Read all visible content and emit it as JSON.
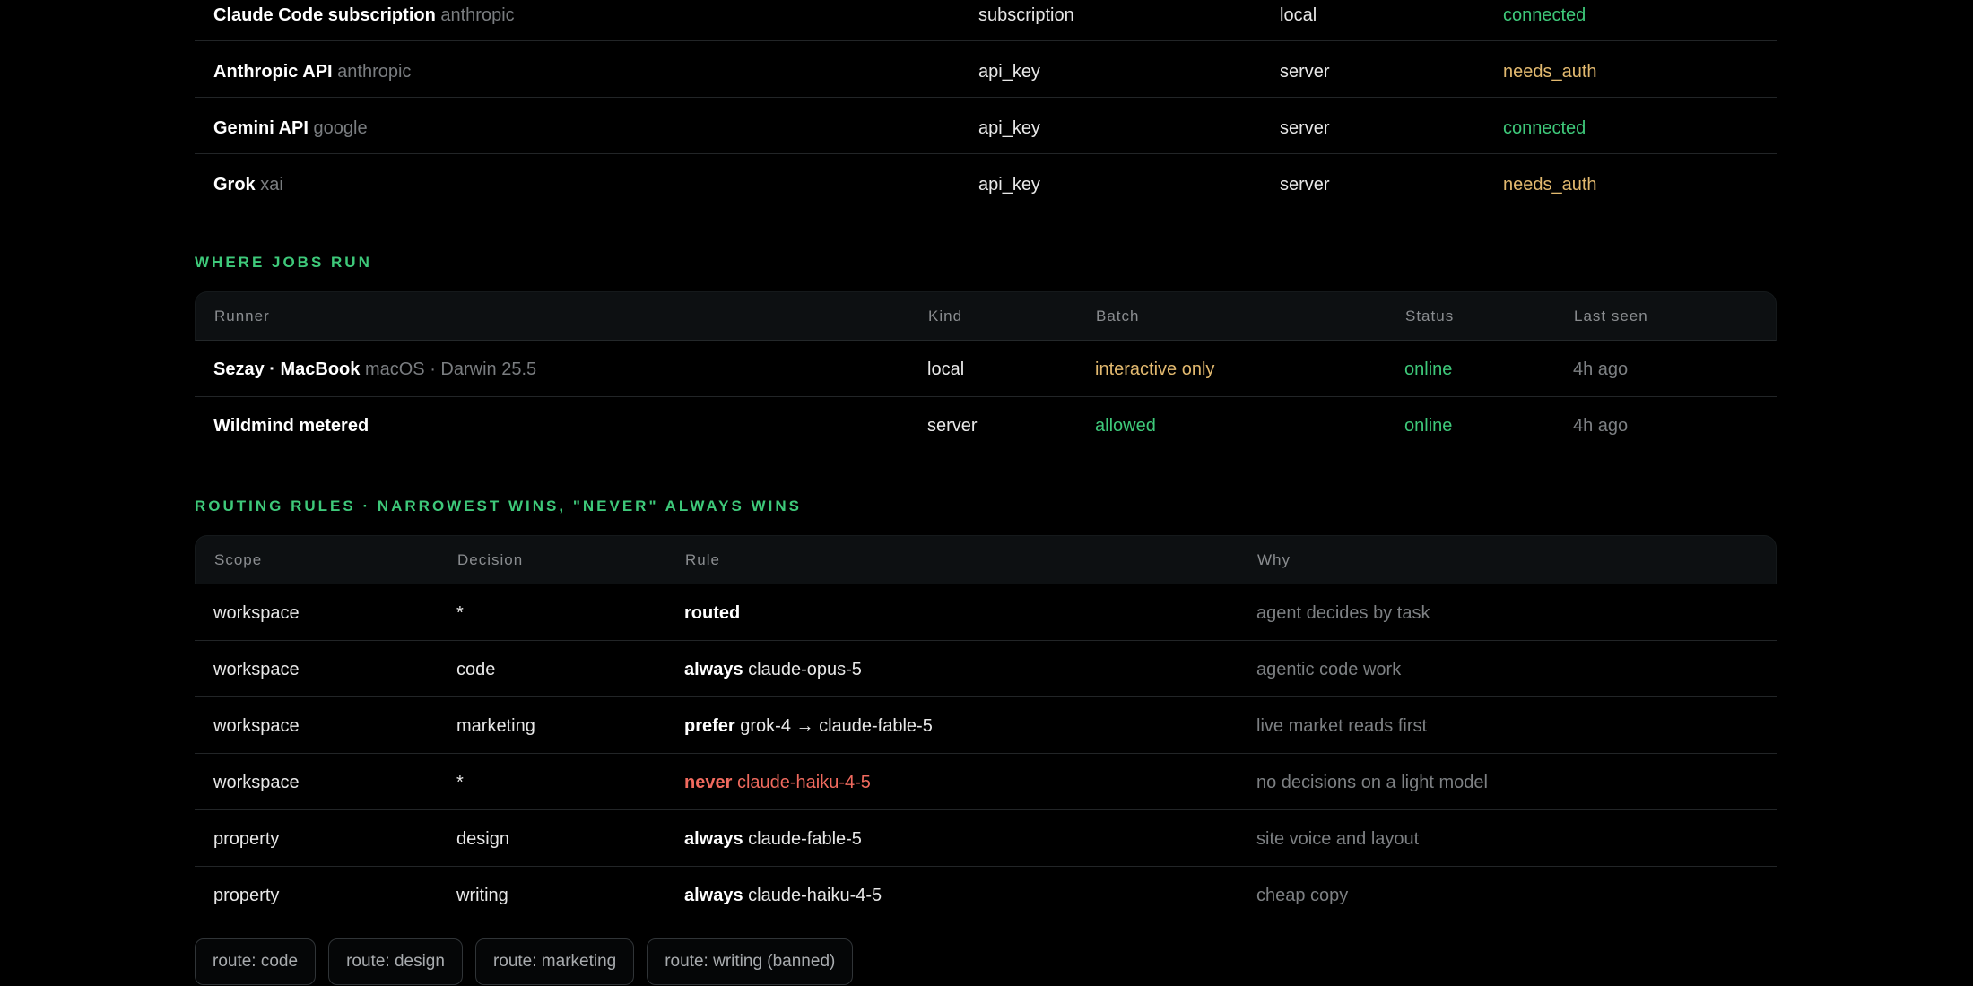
{
  "providers": {
    "rows": [
      {
        "name": "Claude Code subscription",
        "vendor": "anthropic",
        "auth": "subscription",
        "where": "local",
        "status": "connected",
        "status_color": "#3ec97a"
      },
      {
        "name": "Anthropic API",
        "vendor": "anthropic",
        "auth": "api_key",
        "where": "server",
        "status": "needs_auth",
        "status_color": "#e2b96f"
      },
      {
        "name": "Gemini API",
        "vendor": "google",
        "auth": "api_key",
        "where": "server",
        "status": "connected",
        "status_color": "#3ec97a"
      },
      {
        "name": "Grok",
        "vendor": "xai",
        "auth": "api_key",
        "where": "server",
        "status": "needs_auth",
        "status_color": "#e2b96f"
      }
    ]
  },
  "runners": {
    "title": "WHERE JOBS RUN",
    "columns": {
      "runner": "Runner",
      "kind": "Kind",
      "batch": "Batch",
      "status": "Status",
      "last_seen": "Last seen"
    },
    "rows": [
      {
        "name": "Sezay · MacBook",
        "detail": "macOS · Darwin 25.5",
        "kind": "local",
        "batch": "interactive only",
        "batch_color": "#e2b96f",
        "status": "online",
        "last_seen": "4h ago"
      },
      {
        "name": "Wildmind metered",
        "detail": "",
        "kind": "server",
        "batch": "allowed",
        "batch_color": "#3ec97a",
        "status": "online",
        "last_seen": "4h ago"
      }
    ]
  },
  "rules": {
    "title": "ROUTING RULES · NARROWEST WINS, \"NEVER\" ALWAYS WINS",
    "columns": {
      "scope": "Scope",
      "decision": "Decision",
      "rule": "Rule",
      "why": "Why"
    },
    "rows": [
      {
        "scope": "workspace",
        "decision": "*",
        "verb": "routed",
        "target": "",
        "why": "agent decides by task"
      },
      {
        "scope": "workspace",
        "decision": "code",
        "verb": "always",
        "target": "claude-opus-5",
        "why": "agentic code work"
      },
      {
        "scope": "workspace",
        "decision": "marketing",
        "verb": "prefer",
        "target": "grok-4 → claude-fable-5",
        "why": "live market reads first"
      },
      {
        "scope": "workspace",
        "decision": "*",
        "verb": "never",
        "target": "claude-haiku-4-5",
        "why": "no decisions on a light model"
      },
      {
        "scope": "property",
        "decision": "design",
        "verb": "always",
        "target": "claude-fable-5",
        "why": "site voice and layout"
      },
      {
        "scope": "property",
        "decision": "writing",
        "verb": "always",
        "target": "claude-haiku-4-5",
        "why": "cheap copy"
      }
    ]
  },
  "chips": [
    "route: code",
    "route: design",
    "route: marketing",
    "route: writing (banned)"
  ],
  "colors": {
    "accent": "#3ec97a",
    "warning": "#e2b96f",
    "danger": "#f06a5e",
    "muted": "#7d8083"
  }
}
